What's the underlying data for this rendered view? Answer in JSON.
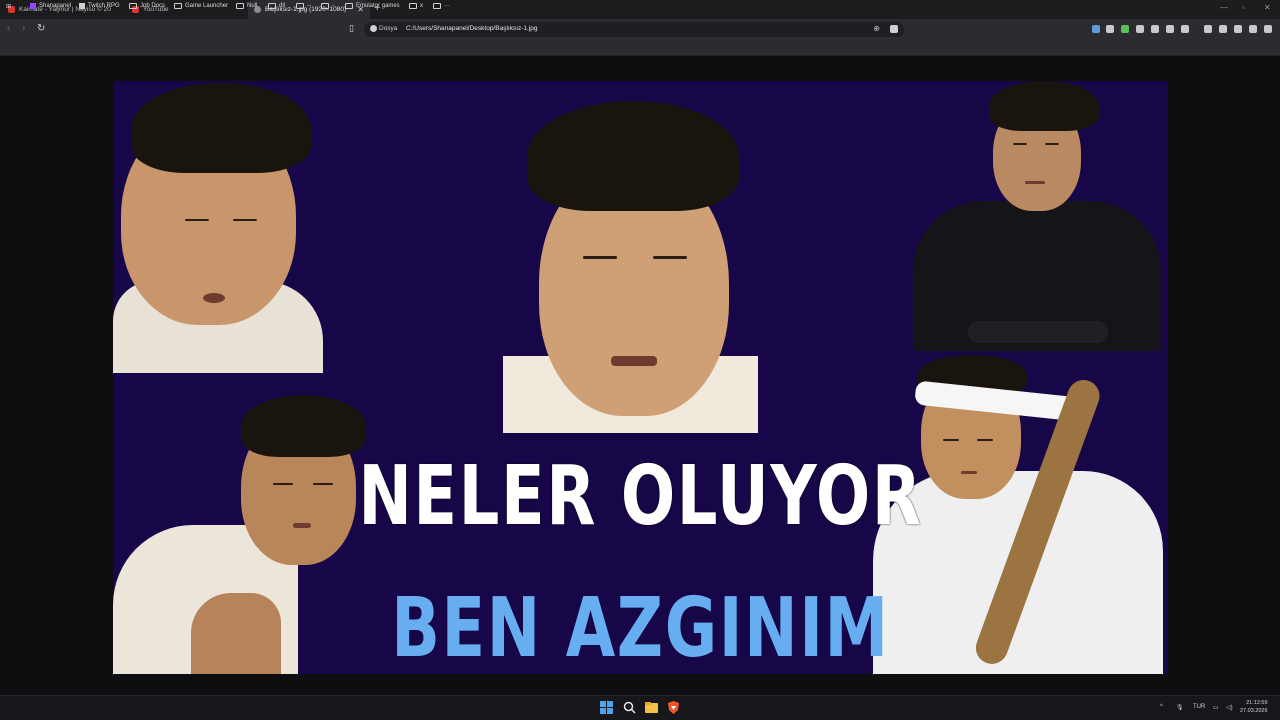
{
  "tabs": [
    {
      "title": "Kaimate - Yaljmur | Nayiso © 20",
      "active": false
    },
    {
      "title": "YouTube",
      "active": false
    },
    {
      "title": "Başlıksız-1.jpg (1920×1080)",
      "active": true
    }
  ],
  "address_bar": {
    "site_label": "Dosya",
    "url": "C:/Users/Shanapanel/Desktop/Başlıksız-1.jpg"
  },
  "bookmarks": [
    "Shanapanel",
    "Twitch RPG",
    "Job Docs",
    "Game Launcher",
    "Null",
    "dll",
    "--",
    "-",
    "Emulator games",
    "x",
    "···"
  ],
  "image": {
    "line1": "NELER OLUYOR",
    "line2": "BEN AZGINIM"
  },
  "taskbar": {
    "language": "TUR",
    "time": "21:12:59",
    "date": "27.03.2026"
  },
  "colors": {
    "art_background": "#180748",
    "headline_white": "#ffffff",
    "headline_blue": "#67aef0"
  }
}
